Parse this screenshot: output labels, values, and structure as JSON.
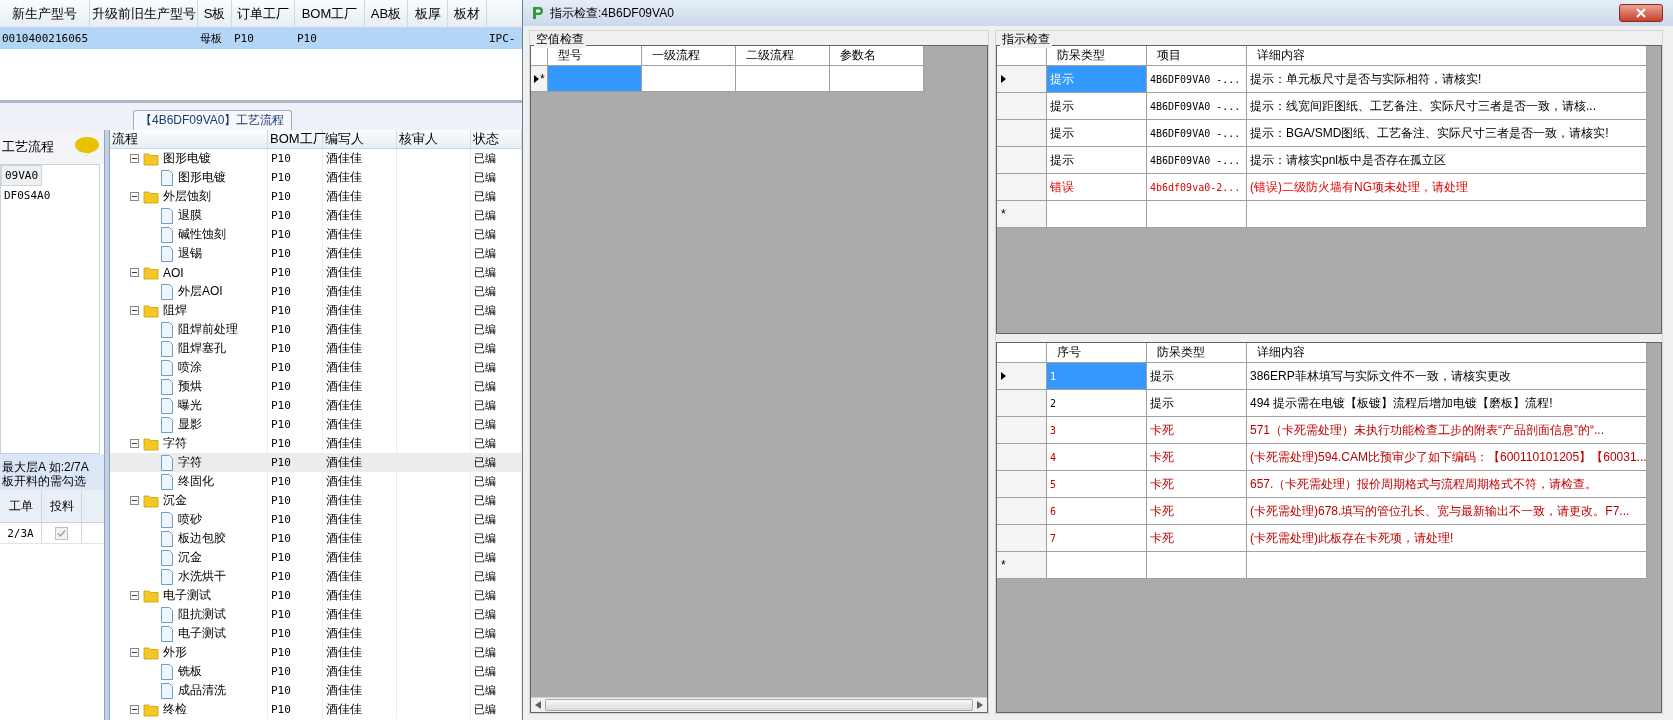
{
  "background_app": {
    "main_table": {
      "columns": [
        "新生产型号",
        "升级前旧生产型号",
        "S板",
        "订单工厂",
        "BOM工厂",
        "AB板",
        "板厚",
        "板材"
      ],
      "rows": [
        {
          "cells": [
            "0010400216065",
            null,
            "母板",
            "P10",
            "P10",
            null,
            null,
            null,
            "IPC-"
          ],
          "selected": true
        }
      ]
    },
    "tab_label": "【4B6DF09VA0】工艺流程",
    "left_panel": {
      "header": "工艺流程",
      "items": [
        {
          "label": "09VA0",
          "selected": true
        },
        {
          "label": "DF0S4A0",
          "selected": false
        }
      ],
      "hint_lines": [
        "最大层A 如:2/7A",
        "板开料的需勾选"
      ],
      "grid": {
        "columns": [
          "工单",
          "投料"
        ],
        "rows": [
          {
            "order": "2/3A",
            "checked": true,
            "disabled": true
          }
        ]
      }
    },
    "process_tree": {
      "columns": [
        "流程",
        "BOM工厂",
        "编写人",
        "核审人",
        "状态"
      ],
      "items": [
        {
          "name": "图形电镀",
          "bom": "P10",
          "writer": "酒佳佳",
          "status": "已编",
          "selected": false,
          "expanded": true,
          "children": [
            {
              "name": "图形电镀",
              "bom": "P10",
              "writer": "酒佳佳",
              "status": "已编",
              "selected": false
            }
          ]
        },
        {
          "name": "外层蚀刻",
          "bom": "P10",
          "writer": "酒佳佳",
          "status": "已编",
          "selected": false,
          "expanded": true,
          "children": [
            {
              "name": "退膜",
              "bom": "P10",
              "writer": "酒佳佳",
              "status": "已编",
              "selected": false
            },
            {
              "name": "碱性蚀刻",
              "bom": "P10",
              "writer": "酒佳佳",
              "status": "已编",
              "selected": false
            },
            {
              "name": "退锡",
              "bom": "P10",
              "writer": "酒佳佳",
              "status": "已编",
              "selected": false
            }
          ]
        },
        {
          "name": "AOI",
          "bom": "P10",
          "writer": "酒佳佳",
          "status": "已编",
          "selected": false,
          "expanded": true,
          "children": [
            {
              "name": "外层AOI",
              "bom": "P10",
              "writer": "酒佳佳",
              "status": "已编",
              "selected": false
            }
          ]
        },
        {
          "name": "阻焊",
          "bom": "P10",
          "writer": "酒佳佳",
          "status": "已编",
          "selected": false,
          "expanded": true,
          "children": [
            {
              "name": "阻焊前处理",
              "bom": "P10",
              "writer": "酒佳佳",
              "status": "已编",
              "selected": false
            },
            {
              "name": "阻焊塞孔",
              "bom": "P10",
              "writer": "酒佳佳",
              "status": "已编",
              "selected": false
            },
            {
              "name": "喷涂",
              "bom": "P10",
              "writer": "酒佳佳",
              "status": "已编",
              "selected": false
            },
            {
              "name": "预烘",
              "bom": "P10",
              "writer": "酒佳佳",
              "status": "已编",
              "selected": false
            },
            {
              "name": "曝光",
              "bom": "P10",
              "writer": "酒佳佳",
              "status": "已编",
              "selected": false
            },
            {
              "name": "显影",
              "bom": "P10",
              "writer": "酒佳佳",
              "status": "已编",
              "selected": false
            }
          ]
        },
        {
          "name": "字符",
          "bom": "P10",
          "writer": "酒佳佳",
          "status": "已编",
          "selected": false,
          "expanded": true,
          "children": [
            {
              "name": "字符",
              "bom": "P10",
              "writer": "酒佳佳",
              "status": "已编",
              "selected": true
            },
            {
              "name": "终固化",
              "bom": "P10",
              "writer": "酒佳佳",
              "status": "已编",
              "selected": false
            }
          ]
        },
        {
          "name": "沉金",
          "bom": "P10",
          "writer": "酒佳佳",
          "status": "已编",
          "selected": false,
          "expanded": true,
          "children": [
            {
              "name": "喷砂",
              "bom": "P10",
              "writer": "酒佳佳",
              "status": "已编",
              "selected": false
            },
            {
              "name": "板边包胶",
              "bom": "P10",
              "writer": "酒佳佳",
              "status": "已编",
              "selected": false
            },
            {
              "name": "沉金",
              "bom": "P10",
              "writer": "酒佳佳",
              "status": "已编",
              "selected": false
            },
            {
              "name": "水洗烘干",
              "bom": "P10",
              "writer": "酒佳佳",
              "status": "已编",
              "selected": false
            }
          ]
        },
        {
          "name": "电子测试",
          "bom": "P10",
          "writer": "酒佳佳",
          "status": "已编",
          "selected": false,
          "expanded": true,
          "children": [
            {
              "name": "阻抗测试",
              "bom": "P10",
              "writer": "酒佳佳",
              "status": "已编",
              "selected": false
            },
            {
              "name": "电子测试",
              "bom": "P10",
              "writer": "酒佳佳",
              "status": "已编",
              "selected": false
            }
          ]
        },
        {
          "name": "外形",
          "bom": "P10",
          "writer": "酒佳佳",
          "status": "已编",
          "selected": false,
          "expanded": true,
          "children": [
            {
              "name": "铣板",
              "bom": "P10",
              "writer": "酒佳佳",
              "status": "已编",
              "selected": false
            },
            {
              "name": "成品清洗",
              "bom": "P10",
              "writer": "酒佳佳",
              "status": "已编",
              "selected": false
            }
          ]
        },
        {
          "name": "终检",
          "bom": "P10",
          "writer": "酒佳佳",
          "status": "已编",
          "selected": false,
          "expanded": true
        }
      ]
    }
  },
  "dialog": {
    "title": "指示检查:4B6DF09VA0",
    "null_check": {
      "title": "空值检查",
      "columns": [
        "型号",
        "一级流程",
        "二级流程",
        "参数名"
      ],
      "new_row_marker": "*",
      "new_row_selected": true
    },
    "instruction_check": {
      "title": "指示检查",
      "top_table": {
        "columns": [
          "防呆类型",
          "项目",
          "详细内容"
        ],
        "new_row_marker": "*",
        "rows": [
          {
            "kind": "notice",
            "type": "提示",
            "item": "4B6DF09VA0 -...",
            "detail": "提示：单元板尺寸是否与实际相符，请核实!",
            "selected": true
          },
          {
            "kind": "notice",
            "type": "提示",
            "item": "4B6DF09VA0 -...",
            "detail": "提示：线宽间距图纸、工艺备注、实际尺寸三者是否一致，请核...",
            "selected": false
          },
          {
            "kind": "notice",
            "type": "提示",
            "item": "4B6DF09VA0 -...",
            "detail": "提示：BGA/SMD图纸、工艺备注、实际尺寸三者是否一致，请核实!",
            "selected": false
          },
          {
            "kind": "notice",
            "type": "提示",
            "item": "4B6DF09VA0 -...",
            "detail": "提示：请核实pnl板中是否存在孤立区",
            "selected": false
          },
          {
            "kind": "error",
            "type": "错误",
            "item": "4b6df09va0-2...",
            "detail": "(错误)二级防火墙有NG项未处理，请处理",
            "selected": false
          }
        ]
      },
      "bottom_table": {
        "columns": [
          "序号",
          "防呆类型",
          "详细内容"
        ],
        "new_row_marker": "*",
        "rows": [
          {
            "kind": "notice",
            "no": "1",
            "type": "提示",
            "detail": "386ERP菲林填写与实际文件不一致，请核实更改",
            "selected": true
          },
          {
            "kind": "notice",
            "no": "2",
            "type": "提示",
            "detail": "494 提示需在电镀【板镀】流程后增加电镀【磨板】流程!",
            "selected": false
          },
          {
            "kind": "blocking",
            "no": "3",
            "type": "卡死",
            "detail": "571（卡死需处理）未执行功能检查工步的附表“产品剖面信息”的“...",
            "selected": false
          },
          {
            "kind": "blocking",
            "no": "4",
            "type": "卡死",
            "detail": "(卡死需处理)594.CAM比预审少了如下编码：【600110101205】【60031...",
            "selected": false
          },
          {
            "kind": "blocking",
            "no": "5",
            "type": "卡死",
            "detail": "657.（卡死需处理）报价周期格式与流程周期格式不符，请检查。",
            "selected": false
          },
          {
            "kind": "blocking",
            "no": "6",
            "type": "卡死",
            "detail": "(卡死需处理)678.填写的管位孔长、宽与最新输出不一致，请更改。F7...",
            "selected": false
          },
          {
            "kind": "blocking",
            "no": "7",
            "type": "卡死",
            "detail": "(卡死需处理)此板存在卡死项，请处理!",
            "selected": false
          }
        ]
      }
    }
  }
}
